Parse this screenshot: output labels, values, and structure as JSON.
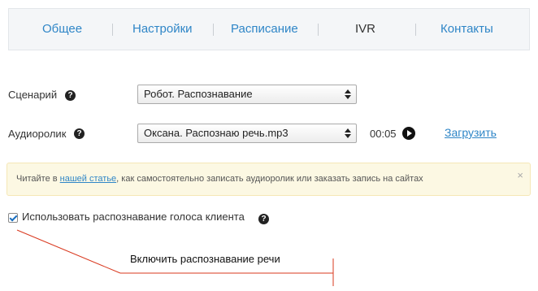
{
  "tabs": [
    {
      "label": "Общее",
      "active": false
    },
    {
      "label": "Настройки",
      "active": false
    },
    {
      "label": "Расписание",
      "active": false
    },
    {
      "label": "IVR",
      "active": true
    },
    {
      "label": "Контакты",
      "active": false
    }
  ],
  "scenario": {
    "label": "Сценарий",
    "value": "Робот. Распознавание"
  },
  "audio": {
    "label": "Аудиоролик",
    "value": "Оксана. Распознаю речь.mp3",
    "duration": "00:05",
    "upload_label": "Загрузить"
  },
  "notice": {
    "prefix": "Читайте в ",
    "link": "нашей статье",
    "suffix": ", как самостоятельно записать аудиоролик или заказать запись на сайтах",
    "close": "×"
  },
  "voice_recognition": {
    "label": "Использовать распознавание голоса клиента",
    "checked": true
  },
  "help_glyph": "?",
  "annotation": {
    "text": "Включить распознавание речи",
    "color": "#d9381e"
  },
  "colors": {
    "link": "#2f86c7",
    "notice_bg": "#fcf8e3",
    "tabs_bg": "#f4f6f8"
  }
}
